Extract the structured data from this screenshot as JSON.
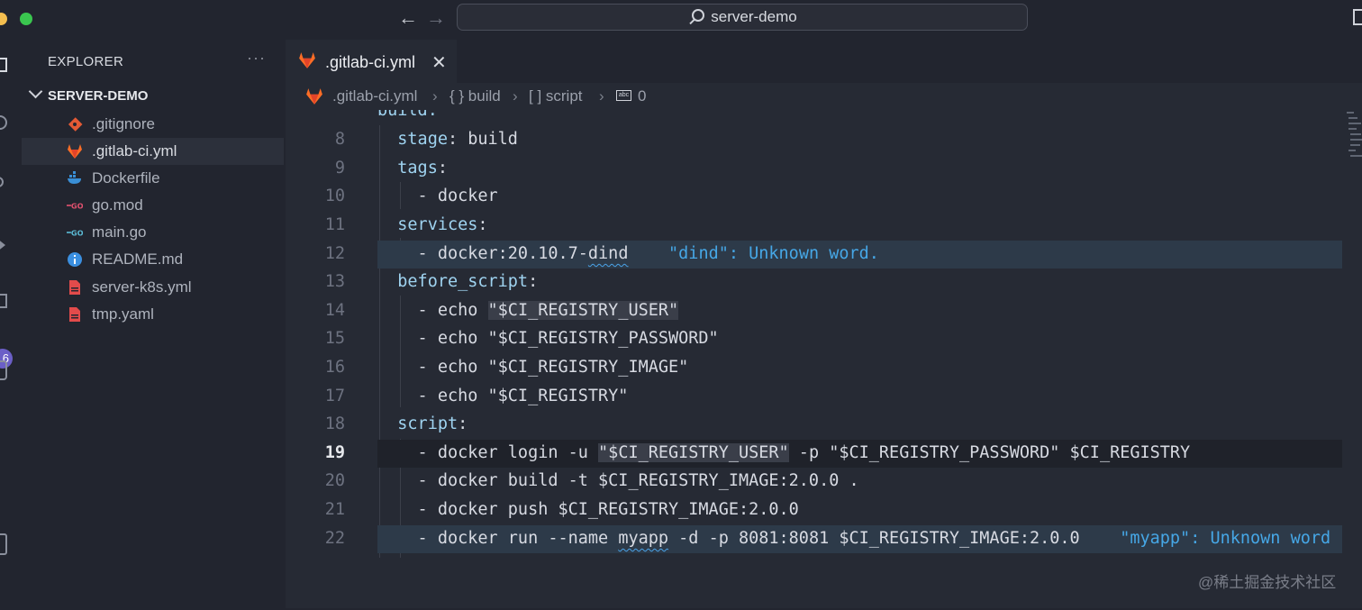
{
  "window": {
    "search_text": "server-demo",
    "traffic_colors": [
      "#f4be4f",
      "#3ac64f"
    ]
  },
  "nav": {
    "back_icon": "←",
    "forward_icon": "→"
  },
  "activity": {
    "badge": "6"
  },
  "explorer": {
    "title": "EXPLORER",
    "more": "···",
    "folder": "SERVER-DEMO",
    "files": [
      {
        "name": ".gitignore",
        "icon": "git-icon"
      },
      {
        "name": ".gitlab-ci.yml",
        "icon": "gitlab-icon"
      },
      {
        "name": "Dockerfile",
        "icon": "docker-icon"
      },
      {
        "name": "go.mod",
        "icon": "go-icon"
      },
      {
        "name": "main.go",
        "icon": "go-icon"
      },
      {
        "name": "README.md",
        "icon": "info-icon"
      },
      {
        "name": "server-k8s.yml",
        "icon": "yaml-icon"
      },
      {
        "name": "tmp.yaml",
        "icon": "yaml-icon"
      }
    ]
  },
  "tab": {
    "label": ".gitlab-ci.yml",
    "close": "✕"
  },
  "breadcrumb": [
    ".gitlab-ci.yml",
    "{ } build",
    "[ ] script",
    "0"
  ],
  "code": {
    "partial_top": "build:",
    "current_line": "19",
    "lines": [
      {
        "n": "8",
        "text": "  stage: build"
      },
      {
        "n": "9",
        "text": "  tags:"
      },
      {
        "n": "10",
        "text": "    - docker"
      },
      {
        "n": "11",
        "text": "  services:"
      },
      {
        "n": "12",
        "text": "    - docker:20.10.7-dind    \"dind\": Unknown word."
      },
      {
        "n": "13",
        "text": "  before_script:"
      },
      {
        "n": "14",
        "text": "    - echo \"$CI_REGISTRY_USER\""
      },
      {
        "n": "15",
        "text": "    - echo \"$CI_REGISTRY_PASSWORD\""
      },
      {
        "n": "16",
        "text": "    - echo \"$CI_REGISTRY_IMAGE\""
      },
      {
        "n": "17",
        "text": "    - echo \"$CI_REGISTRY\""
      },
      {
        "n": "18",
        "text": "  script:"
      },
      {
        "n": "19",
        "text": "    - docker login -u \"$CI_REGISTRY_USER\" -p \"$CI_REGISTRY_PASSWORD\" $CI_REGISTRY"
      },
      {
        "n": "20",
        "text": "    - docker build -t $CI_REGISTRY_IMAGE:2.0.0 ."
      },
      {
        "n": "21",
        "text": "    - docker push $CI_REGISTRY_IMAGE:2.0.0"
      },
      {
        "n": "22",
        "text": "    - docker run --name myapp -d -p 8081:8081 $CI_REGISTRY_IMAGE:2.0.0    \"myapp\": Unknown word"
      }
    ]
  },
  "watermark": "@稀土掘金技术社区"
}
